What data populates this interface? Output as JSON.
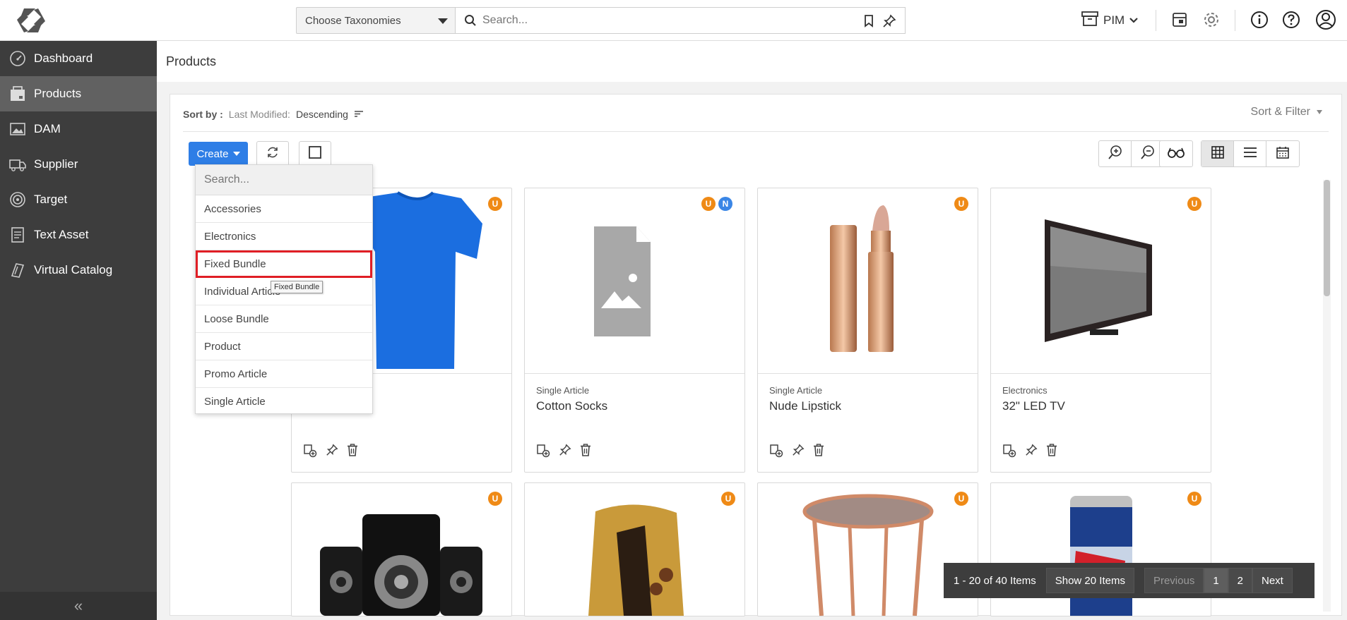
{
  "topbar": {
    "taxonomy_label": "Choose Taxonomies",
    "search_placeholder": "Search...",
    "module_label": "PIM"
  },
  "sidebar": {
    "items": [
      {
        "label": "Dashboard",
        "icon": "gauge-icon"
      },
      {
        "label": "Products",
        "icon": "products-icon"
      },
      {
        "label": "DAM",
        "icon": "image-icon"
      },
      {
        "label": "Supplier",
        "icon": "truck-icon"
      },
      {
        "label": "Target",
        "icon": "target-icon"
      },
      {
        "label": "Text Asset",
        "icon": "document-icon"
      },
      {
        "label": "Virtual Catalog",
        "icon": "catalog-icon"
      }
    ],
    "active": "Products",
    "collapse_symbol": "«"
  },
  "page": {
    "title": "Products"
  },
  "sort": {
    "label": "Sort by :",
    "key": "Last Modified:",
    "direction": "Descending",
    "filter_label": "Sort & Filter"
  },
  "toolbar": {
    "create_label": "Create"
  },
  "dropdown": {
    "search_placeholder": "Search...",
    "items": [
      "Accessories",
      "Electronics",
      "Fixed Bundle",
      "Individual Article",
      "Loose Bundle",
      "Product",
      "Promo Article",
      "Single Article"
    ],
    "highlighted": "Fixed Bundle",
    "tooltip": "Fixed Bundle"
  },
  "cards": [
    {
      "category": "",
      "name": "",
      "badges": [
        "U"
      ]
    },
    {
      "category": "Single Article",
      "name": "Cotton Socks",
      "badges": [
        "U",
        "N"
      ]
    },
    {
      "category": "Single Article",
      "name": "Nude Lipstick",
      "badges": [
        "U"
      ]
    },
    {
      "category": "Electronics",
      "name": "32\" LED TV",
      "badges": [
        "U"
      ]
    },
    {
      "category": "",
      "name": "",
      "badges": [
        "U"
      ]
    },
    {
      "category": "",
      "name": "",
      "badges": [
        "U"
      ]
    },
    {
      "category": "",
      "name": "",
      "badges": [
        "U"
      ]
    },
    {
      "category": "",
      "name": "",
      "badges": [
        "U"
      ]
    }
  ],
  "pagination": {
    "info": "1 - 20 of 40 Items",
    "show": "Show 20 Items",
    "previous": "Previous",
    "pages": [
      "1",
      "2"
    ],
    "next": "Next"
  },
  "colors": {
    "accent": "#2e7ee6",
    "sidebar": "#3d3d3d",
    "badge_u": "#ef8a16",
    "badge_n": "#3a86e6",
    "highlight": "#e01e25"
  }
}
